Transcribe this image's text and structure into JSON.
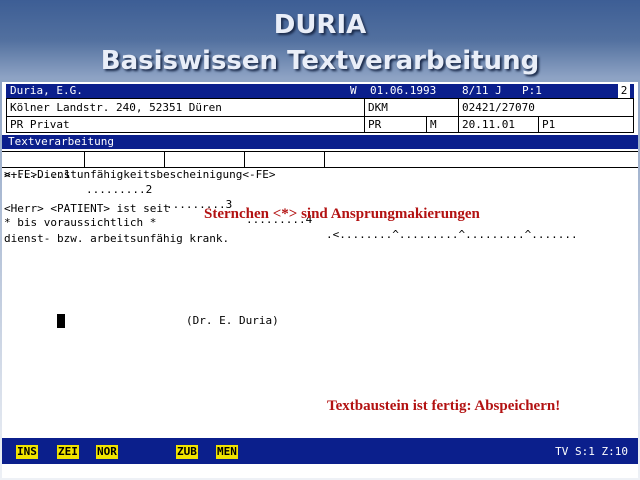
{
  "slide": {
    "title": "DURIA",
    "subtitle": "Basiswissen Textverarbeitung"
  },
  "header": {
    "row1": {
      "name": "Duria, E.G.",
      "flag": "W",
      "date": "01.06.1993",
      "age": "8/11 J",
      "page": "P:1",
      "count": "2"
    },
    "row2": {
      "address": "Kölner Landstr. 240, 52351 Düren",
      "insurer": "DKM",
      "phone": "02421/27070"
    },
    "row3": {
      "status": "PR Privat",
      "type": "PR",
      "sex": "M",
      "visit_date": "20.11.01",
      "code": "P1"
    }
  },
  "section_label": "Textverarbeitung",
  "ruler": {
    "seg1": ">........1",
    "seg2": ".........2",
    "seg3": ".........3",
    "seg4": ".........4",
    "seg5": ".<........^.........^.........^......."
  },
  "document": {
    "line1": "<+FE>Dienstunfähigkeitsbescheinigung<-FE>",
    "line2": "<Herr> <PATIENT> ist seit",
    "line3": "* bis voraussichtlich *",
    "line4": "dienst- bzw. arbeitsunfähig krank.",
    "signature": "(Dr. E. Duria)"
  },
  "annotations": {
    "note1": "Sternchen <*> sind Ansprungmakierungen",
    "note2": "Textbaustein ist fertig: Abspeichern!"
  },
  "status_bar": {
    "keys": [
      "INS",
      "ZEI",
      "NOR",
      "ZUB",
      "MEN"
    ],
    "right": "TV S:1 Z:10"
  },
  "colors": {
    "header_blue": "#0b1f8c",
    "key_yellow": "#f1e400",
    "annotation_red": "#b31212"
  }
}
